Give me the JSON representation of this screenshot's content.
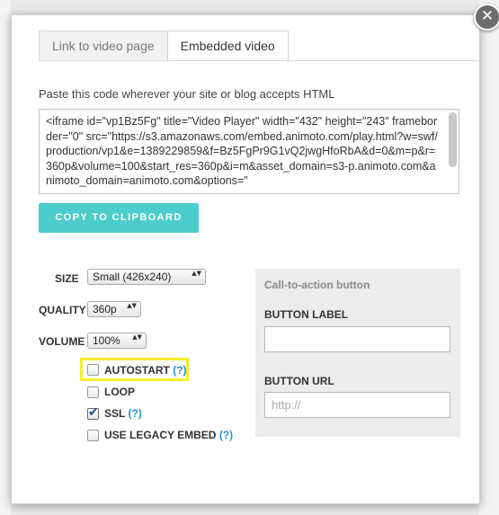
{
  "tabs": [
    {
      "label": "Link to video page",
      "active": false
    },
    {
      "label": "Embedded video",
      "active": true
    }
  ],
  "instructions": "Paste this code wherever your site or blog accepts HTML",
  "embed_code": "<iframe id=\"vp1Bz5Fg\" title=\"Video Player\" width=\"432\" height=\"243\" frameborder=\"0\" src=\"https://s3.amazonaws.com/embed.animoto.com/play.html?w=swf/production/vp1&e=1389229859&f=Bz5FgPr9G1vQ2jwgHfoRbA&d=0&m=p&r=360p&volume=100&start_res=360p&i=m&asset_domain=s3-p.animoto.com&animoto_domain=animoto.com&options=\"",
  "copy_button": "COPY TO CLIPBOARD",
  "settings": {
    "size_label": "SIZE",
    "size_value": "Small (426x240)",
    "quality_label": "QUALITY",
    "quality_value": "360p",
    "volume_label": "VOLUME",
    "volume_value": "100%"
  },
  "options": {
    "autostart": {
      "label": "AUTOSTART",
      "help": "(?)",
      "checked": false
    },
    "loop": {
      "label": "LOOP",
      "checked": false
    },
    "ssl": {
      "label": "SSL",
      "help": "(?)",
      "checked": true
    },
    "legacy": {
      "label": "USE LEGACY EMBED",
      "help": "(?)",
      "checked": false
    }
  },
  "cta": {
    "title": "Call-to-action button",
    "button_label_label": "BUTTON LABEL",
    "button_label_value": "",
    "button_url_label": "BUTTON URL",
    "button_url_placeholder": "http://"
  },
  "close_glyph": "✕",
  "arrows_glyph": "▲▼",
  "colors": {
    "accent": "#4ccccc",
    "highlight": "#f7ec2c",
    "help_link": "#2a8fd6"
  }
}
